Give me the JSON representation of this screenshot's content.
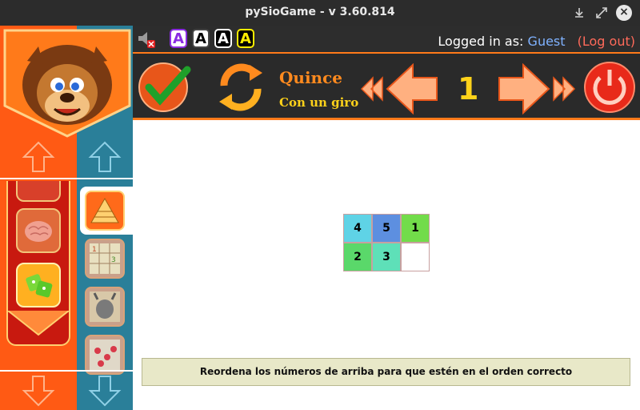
{
  "window": {
    "title": "pySioGame - v 3.60.814",
    "minimize_icon": "download-icon",
    "maximize_icon": "expand-icon",
    "close_label": "×"
  },
  "infobar": {
    "font_buttons": [
      "A",
      "A",
      "A",
      "A"
    ],
    "login_prefix": "Logged in as:",
    "user": "Guest",
    "logout": "(Log out)"
  },
  "toolbar": {
    "game_title": "Quince",
    "game_subtitle": "Con un giro",
    "level": "1",
    "colors": {
      "title": "#ff8a1e",
      "subtitle": "#ffd21a",
      "level": "#ffd21a"
    }
  },
  "board": {
    "cells": [
      {
        "value": "4",
        "color": "#5fd3e6"
      },
      {
        "value": "5",
        "color": "#5d8fe0"
      },
      {
        "value": "1",
        "color": "#72dc4a"
      },
      {
        "value": "2",
        "color": "#5ad86a"
      },
      {
        "value": "3",
        "color": "#5ee0b8"
      },
      {
        "value": "",
        "color": "#ffffff"
      }
    ]
  },
  "instruction": "Reordena los números de arriba para que estén en el orden correcto",
  "colors": {
    "sidebar_orange": "#ff5a14",
    "sidebar_teal": "#2a7f99",
    "accent": "#ff7a1a"
  }
}
